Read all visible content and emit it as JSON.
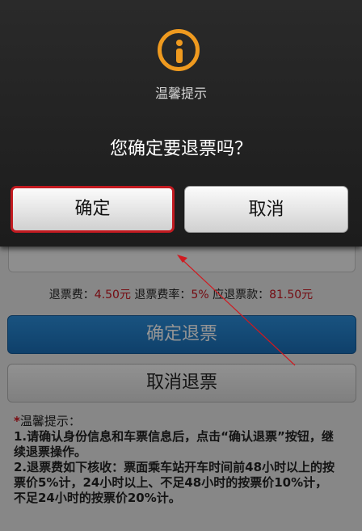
{
  "dialog": {
    "title": "温馨提示",
    "message": "您确定要退票吗？",
    "confirm_label": "确定",
    "cancel_label": "取消",
    "icon": "info-icon",
    "accent_color": "#ef9a1f",
    "highlight_color": "#c21a20"
  },
  "fees": {
    "fee_label": "退票费：",
    "fee_value": "4.50元",
    "rate_label": "退票费率：",
    "rate_value": "5%",
    "refund_label": "应退票款：",
    "refund_value": "81.50元"
  },
  "buttons": {
    "confirm_refund": "确定退票",
    "cancel_refund": "取消退票"
  },
  "tips": {
    "star": "*",
    "title": "温馨提示：",
    "line1": "1.请确认身份信息和车票信息后，点击“确认退票”按钮，继续退票操作。",
    "line2": "2.退票费如下核收：票面乘车站开车时间前48小时以上的按票价5%计，24小时以上、不足48小时的按票价10%计，不足24小时的按票价20%计。"
  }
}
